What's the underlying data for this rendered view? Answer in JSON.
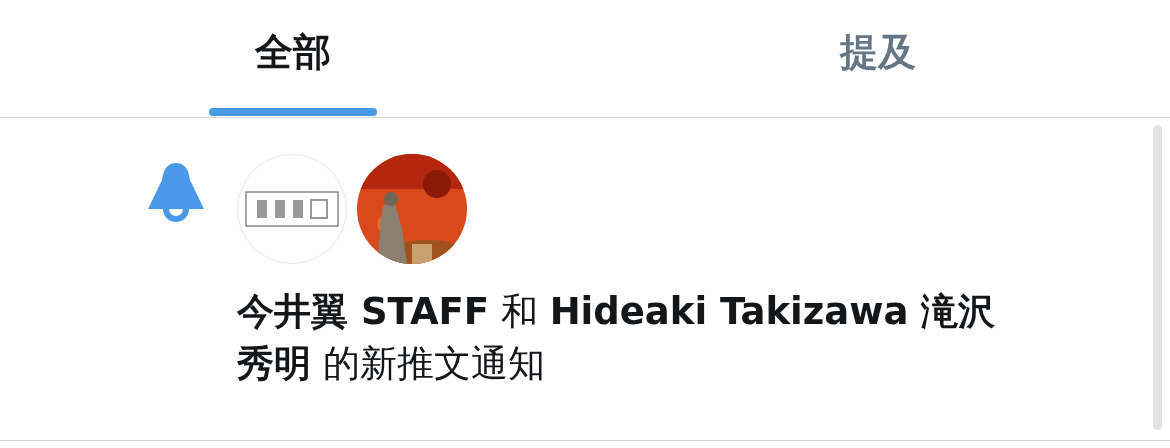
{
  "tabs": [
    {
      "label": "全部",
      "selected": true
    },
    {
      "label": "提及",
      "selected": false
    }
  ],
  "notifications": [
    {
      "kind": "tweet",
      "text": "**今井翼 STAFF** 和 **Hideaki Takizawa 滝沢秀明** 的新推文通知"
    }
  ]
}
